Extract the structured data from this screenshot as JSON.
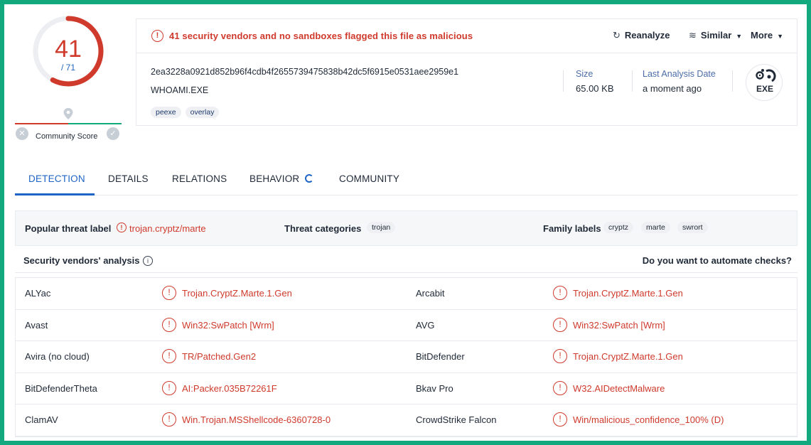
{
  "score": {
    "detections": "41",
    "total": "/ 71",
    "community_label": "Community Score"
  },
  "colors": {
    "accent": "#1e64c4",
    "malicious": "#cf3a2c",
    "frame": "#12a97e"
  },
  "alert": {
    "text": "41 security vendors and no sandboxes flagged this file as malicious"
  },
  "actions": {
    "reanalyze": "Reanalyze",
    "similar": "Similar",
    "more": "More"
  },
  "file": {
    "hash": "2ea3228a0921d852b96f4cdb4f2655739475838b42dc5f6915e0531aee2959e1",
    "name": "WHOAMI.EXE",
    "tags": [
      "peexe",
      "overlay"
    ],
    "size_label": "Size",
    "size_value": "65.00 KB",
    "date_label": "Last Analysis Date",
    "date_value": "a moment ago",
    "type_badge": "EXE"
  },
  "tabs": [
    "DETECTION",
    "DETAILS",
    "RELATIONS",
    "BEHAVIOR",
    "COMMUNITY"
  ],
  "threat": {
    "popular_label": "Popular threat label",
    "popular_value": "trojan.cryptz/marte",
    "categories_label": "Threat categories",
    "categories": [
      "trojan"
    ],
    "family_label": "Family labels",
    "families": [
      "cryptz",
      "marte",
      "swrort"
    ]
  },
  "vendors": {
    "title": "Security vendors' analysis",
    "automate": "Do you want to automate checks?",
    "rows": [
      {
        "left_name": "ALYac",
        "left_result": "Trojan.CryptZ.Marte.1.Gen",
        "right_name": "Arcabit",
        "right_result": "Trojan.CryptZ.Marte.1.Gen"
      },
      {
        "left_name": "Avast",
        "left_result": "Win32:SwPatch [Wrm]",
        "right_name": "AVG",
        "right_result": "Win32:SwPatch [Wrm]"
      },
      {
        "left_name": "Avira (no cloud)",
        "left_result": "TR/Patched.Gen2",
        "right_name": "BitDefender",
        "right_result": "Trojan.CryptZ.Marte.1.Gen"
      },
      {
        "left_name": "BitDefenderTheta",
        "left_result": "AI:Packer.035B72261F",
        "right_name": "Bkav Pro",
        "right_result": "W32.AIDetectMalware"
      },
      {
        "left_name": "ClamAV",
        "left_result": "Win.Trojan.MSShellcode-6360728-0",
        "right_name": "CrowdStrike Falcon",
        "right_result": "Win/malicious_confidence_100% (D)"
      }
    ]
  }
}
